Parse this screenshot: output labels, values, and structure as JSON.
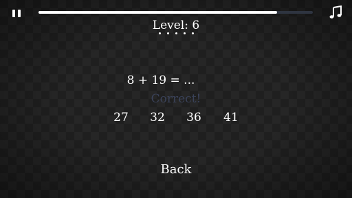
{
  "hud": {
    "pause_icon": "pause-icon",
    "music_icon": "music-note-icon",
    "progress_fraction": 0.87
  },
  "level": {
    "text": "Level: 6",
    "dots_count": 5
  },
  "question": {
    "text": "8 + 19 = ..."
  },
  "feedback": {
    "text": "Correct!",
    "color": "#3a4259"
  },
  "answers": [
    "27",
    "32",
    "36",
    "41"
  ],
  "back_label": "Back",
  "colors": {
    "text": "#ffffff",
    "background": "#1f1f1f",
    "track": "#2e3440"
  }
}
